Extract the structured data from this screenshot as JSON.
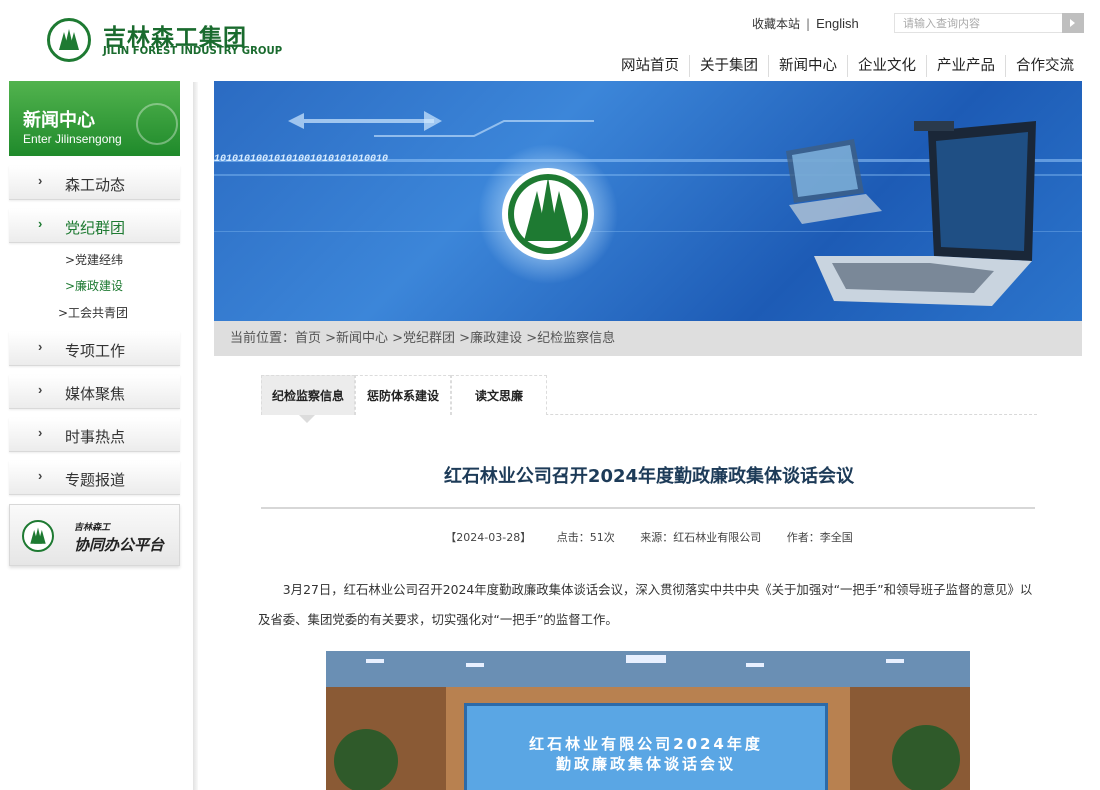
{
  "header": {
    "logo_cn": "吉林森工集团",
    "logo_en": "JILIN FOREST INDUSTRY GROUP",
    "bookmark": "收藏本站",
    "separator": "|",
    "english": "English",
    "search_placeholder": "请输入查询内容"
  },
  "nav": [
    "网站首页",
    "关于集团",
    "新闻中心",
    "企业文化",
    "产业产品",
    "合作交流"
  ],
  "sidebar": {
    "title": "新闻中心",
    "subtitle": "Enter Jilinsengong",
    "items": [
      {
        "label": "森工动态"
      },
      {
        "label": "党纪群团"
      },
      {
        "label": "专项工作"
      },
      {
        "label": "媒体聚焦"
      },
      {
        "label": "时事热点"
      },
      {
        "label": "专题报道"
      }
    ],
    "subitems": [
      {
        "label": ">党建经纬"
      },
      {
        "label": ">廉政建设"
      },
      {
        "label": ">工会共青团"
      }
    ],
    "oa_small": "吉林森工",
    "oa_label": "协同办公平台"
  },
  "banner": {
    "binary_text": "10101010010101001010101010010"
  },
  "breadcrumb": "当前位置：首页 >新闻中心 >党纪群团 >廉政建设 >纪检监察信息",
  "tabs": [
    {
      "label": "纪检监察信息"
    },
    {
      "label": "惩防体系建设"
    },
    {
      "label": "读文思廉"
    }
  ],
  "article": {
    "title": "红石林业公司召开2024年度勤政廉政集体谈话会议",
    "date": "【2024-03-28】",
    "clicks": "点击：51次",
    "source": "来源：红石林业有限公司",
    "author": "作者：李全国",
    "paragraph": "3月27日，红石林业公司召开2024年度勤政廉政集体谈话会议，深入贯彻落实中共中央《关于加强对“一把手”和领导班子监督的意见》以及省委、集团党委的有关要求，切实强化对“一把手”的监督工作。",
    "photo_line1": "红石林业有限公司2024年度",
    "photo_line2": "勤政廉政集体谈话会议"
  },
  "colors": {
    "brand_green": "#1e7a32",
    "title_blue": "#1d3b58",
    "banner_blue": "#2b6bc2"
  }
}
